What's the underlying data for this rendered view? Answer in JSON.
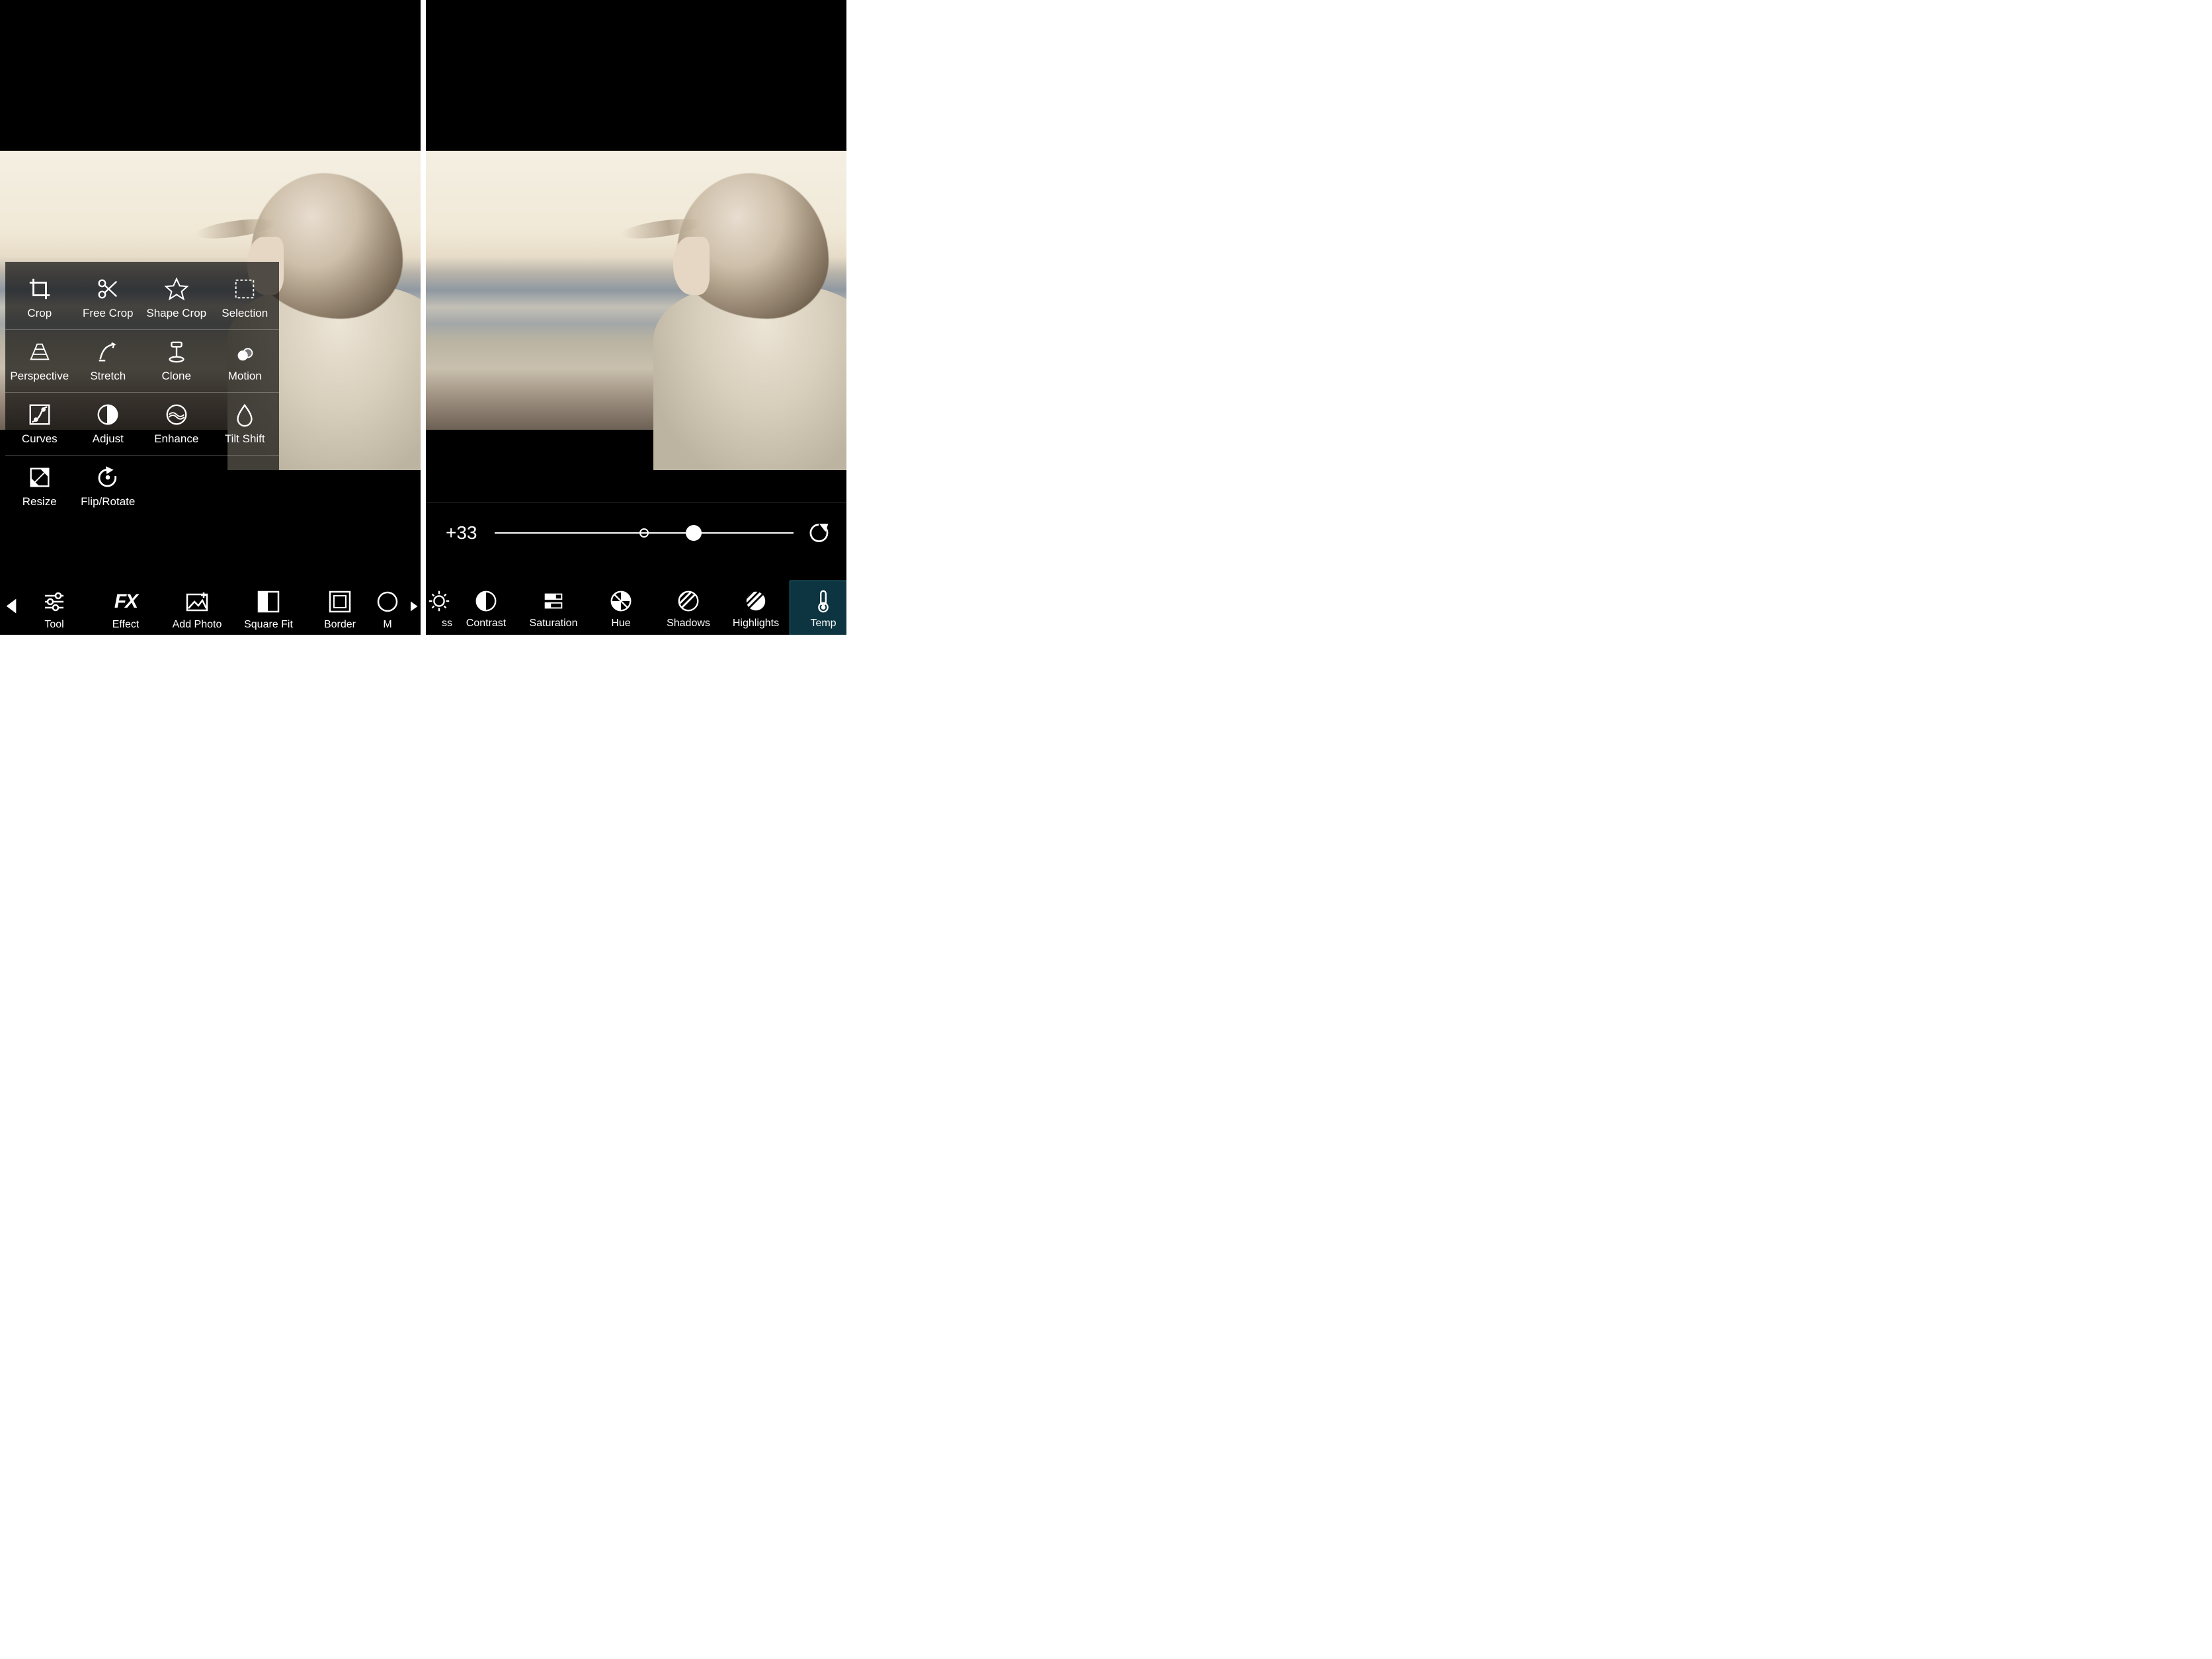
{
  "leftPane": {
    "toolGrid": {
      "rows": [
        [
          {
            "id": "crop",
            "label": "Crop",
            "icon": "crop-icon"
          },
          {
            "id": "free-crop",
            "label": "Free Crop",
            "icon": "scissors-icon"
          },
          {
            "id": "shape-crop",
            "label": "Shape Crop",
            "icon": "star-icon"
          },
          {
            "id": "selection",
            "label": "Selection",
            "icon": "selection-icon"
          }
        ],
        [
          {
            "id": "perspective",
            "label": "Perspective",
            "icon": "perspective-icon"
          },
          {
            "id": "stretch",
            "label": "Stretch",
            "icon": "stretch-icon"
          },
          {
            "id": "clone",
            "label": "Clone",
            "icon": "clone-icon"
          },
          {
            "id": "motion",
            "label": "Motion",
            "icon": "motion-icon"
          }
        ],
        [
          {
            "id": "curves",
            "label": "Curves",
            "icon": "curves-icon"
          },
          {
            "id": "adjust",
            "label": "Adjust",
            "icon": "adjust-icon"
          },
          {
            "id": "enhance",
            "label": "Enhance",
            "icon": "enhance-icon"
          },
          {
            "id": "tilt-shift",
            "label": "Tilt Shift",
            "icon": "droplet-icon"
          }
        ],
        [
          {
            "id": "resize",
            "label": "Resize",
            "icon": "resize-icon"
          },
          {
            "id": "flip-rotate",
            "label": "Flip/Rotate",
            "icon": "rotate-icon"
          },
          {
            "empty": true
          },
          {
            "empty": true
          }
        ]
      ]
    },
    "bottomBar": {
      "items": [
        {
          "id": "tool",
          "label": "Tool",
          "icon": "sliders-icon"
        },
        {
          "id": "effect",
          "label": "Effect",
          "icon": "fx-icon"
        },
        {
          "id": "add-photo",
          "label": "Add Photo",
          "icon": "add-photo-icon"
        },
        {
          "id": "square-fit",
          "label": "Square Fit",
          "icon": "square-fit-icon"
        },
        {
          "id": "border",
          "label": "Border",
          "icon": "border-icon"
        },
        {
          "id": "mask",
          "label": "M",
          "icon": "mask-icon",
          "partial": true
        }
      ]
    }
  },
  "rightPane": {
    "slider": {
      "label": "Temp",
      "value_display": "+33",
      "value_numeric": 33,
      "min": -100,
      "max": 100,
      "thumb_percent": 66.5
    },
    "adjustBar": {
      "items": [
        {
          "id": "brightness",
          "label": "ss",
          "icon": "brightness-icon",
          "partial": "left"
        },
        {
          "id": "contrast",
          "label": "Contrast",
          "icon": "contrast-icon"
        },
        {
          "id": "saturation",
          "label": "Saturation",
          "icon": "saturation-icon"
        },
        {
          "id": "hue",
          "label": "Hue",
          "icon": "hue-icon"
        },
        {
          "id": "shadows",
          "label": "Shadows",
          "icon": "shadows-icon"
        },
        {
          "id": "highlights",
          "label": "Highlights",
          "icon": "highlights-icon"
        },
        {
          "id": "temp",
          "label": "Temp",
          "icon": "temp-icon",
          "selected": true
        }
      ]
    }
  }
}
